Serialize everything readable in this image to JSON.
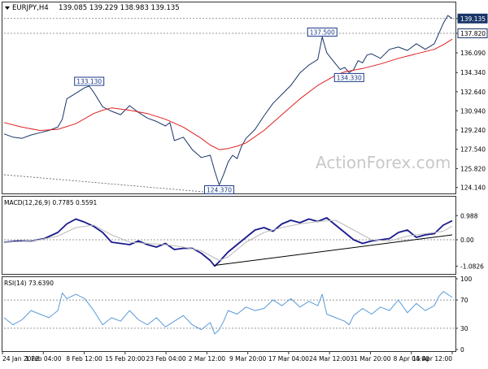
{
  "header": {
    "symbol": "EURJPY,H4",
    "ohlc": "139.085 139.229 138.983 139.135"
  },
  "watermark": "ActionForex.com",
  "colors": {
    "price": "#1a3568",
    "ma": "#e02020",
    "macd": "#1a1a8c",
    "signal": "#bbbbbb",
    "rsi": "#5a9ad8",
    "label_border": "#1a3a88",
    "current_price_box": "#1a3568"
  },
  "chart_data": [
    {
      "type": "line",
      "panel": "price",
      "ylim": [
        123.9,
        140.2
      ],
      "x_range": [
        0,
        100
      ],
      "y_ticks": [
        "139.135",
        "137.820",
        "136.090",
        "134.340",
        "132.640",
        "130.940",
        "129.240",
        "127.540",
        "125.820",
        "124.140"
      ],
      "y_tick_values": [
        139.135,
        137.82,
        136.09,
        134.34,
        132.64,
        130.94,
        129.24,
        127.54,
        125.82,
        124.14
      ],
      "current_price": "139.135",
      "series": [
        {
          "role": "price",
          "x": [
            0,
            2,
            4,
            6,
            8,
            10,
            12,
            13,
            14,
            16,
            18,
            19,
            20,
            22,
            24,
            26,
            28,
            30,
            32,
            34,
            36,
            37,
            38,
            40,
            42,
            44,
            46,
            47,
            48,
            49,
            50,
            51,
            52,
            53,
            54,
            56,
            58,
            60,
            62,
            64,
            66,
            68,
            70,
            71,
            72,
            73,
            74,
            75,
            76,
            77,
            78,
            79,
            80,
            81,
            82,
            84,
            86,
            88,
            90,
            92,
            94,
            96,
            97,
            98,
            99,
            100
          ],
          "values": [
            128.9,
            128.6,
            128.5,
            128.8,
            129.0,
            129.2,
            129.5,
            130.2,
            132.0,
            132.5,
            133.0,
            133.13,
            132.6,
            131.3,
            130.9,
            130.6,
            131.4,
            130.8,
            130.3,
            130.0,
            129.6,
            129.9,
            128.3,
            128.6,
            127.5,
            126.8,
            127.0,
            125.6,
            124.37,
            125.3,
            126.4,
            127.0,
            126.7,
            127.8,
            128.5,
            129.3,
            130.5,
            131.6,
            132.4,
            133.2,
            134.3,
            135.0,
            135.5,
            137.5,
            136.1,
            135.6,
            135.1,
            134.6,
            134.8,
            134.33,
            134.6,
            135.4,
            135.2,
            135.9,
            136.0,
            135.6,
            136.4,
            136.6,
            136.3,
            136.9,
            136.4,
            136.9,
            137.8,
            138.7,
            139.4,
            139.135
          ]
        },
        {
          "role": "moving-average",
          "x": [
            0,
            4,
            8,
            12,
            16,
            20,
            22,
            24,
            28,
            32,
            36,
            40,
            44,
            46,
            48,
            50,
            52,
            54,
            58,
            62,
            66,
            70,
            74,
            76,
            80,
            84,
            88,
            92,
            96,
            98,
            100
          ],
          "values": [
            129.9,
            129.5,
            129.2,
            129.3,
            129.8,
            130.7,
            131.0,
            131.2,
            131.0,
            130.7,
            130.2,
            129.5,
            128.5,
            127.9,
            127.5,
            127.6,
            127.8,
            128.1,
            129.2,
            130.6,
            132.0,
            133.2,
            134.1,
            134.4,
            134.7,
            135.1,
            135.6,
            136.0,
            136.4,
            136.8,
            137.3
          ]
        }
      ],
      "annotations": [
        "133.130",
        "124.370",
        "137.500",
        "134.330"
      ],
      "dotted_line_levels": [
        137.82,
        139.135
      ]
    },
    {
      "type": "line",
      "panel": "macd",
      "title": "MACD(12,26,9) 0.7785 0.5591",
      "ylim": [
        -1.3,
        1.3
      ],
      "y_ticks": [
        "0.988",
        "0.00",
        "-1.0826"
      ],
      "y_tick_values": [
        0.988,
        0.0,
        -1.0826
      ],
      "series": [
        {
          "role": "macd",
          "x": [
            0,
            3,
            6,
            9,
            12,
            14,
            16,
            18,
            20,
            22,
            24,
            26,
            28,
            30,
            32,
            34,
            36,
            38,
            40,
            42,
            44,
            46,
            47,
            48,
            50,
            52,
            54,
            56,
            58,
            60,
            62,
            64,
            66,
            68,
            70,
            72,
            74,
            76,
            78,
            80,
            82,
            84,
            86,
            88,
            90,
            92,
            94,
            96,
            98,
            100
          ],
          "values": [
            -0.1,
            -0.05,
            -0.05,
            0.05,
            0.3,
            0.65,
            0.85,
            0.72,
            0.55,
            0.3,
            -0.1,
            -0.15,
            -0.2,
            -0.05,
            -0.2,
            -0.3,
            -0.15,
            -0.4,
            -0.35,
            -0.35,
            -0.55,
            -0.85,
            -1.08,
            -0.9,
            -0.5,
            -0.2,
            0.1,
            0.4,
            0.5,
            0.35,
            0.65,
            0.8,
            0.7,
            0.85,
            0.75,
            0.9,
            0.6,
            0.3,
            0.0,
            -0.15,
            -0.05,
            0.0,
            0.05,
            0.3,
            0.4,
            0.1,
            0.2,
            0.25,
            0.6,
            0.78
          ]
        },
        {
          "role": "signal",
          "x": [
            0,
            4,
            8,
            12,
            16,
            20,
            24,
            28,
            32,
            36,
            40,
            44,
            46,
            48,
            50,
            54,
            58,
            62,
            66,
            70,
            74,
            78,
            82,
            86,
            90,
            94,
            98,
            100
          ],
          "values": [
            -0.1,
            -0.07,
            0.0,
            0.15,
            0.5,
            0.6,
            0.2,
            -0.1,
            -0.15,
            -0.2,
            -0.3,
            -0.45,
            -0.65,
            -0.85,
            -0.7,
            -0.1,
            0.3,
            0.5,
            0.65,
            0.75,
            0.8,
            0.4,
            0.0,
            -0.05,
            0.15,
            0.25,
            0.35,
            0.56
          ]
        }
      ],
      "trendline": {
        "x": [
          47,
          100
        ],
        "values": [
          -1.05,
          0.2
        ]
      }
    },
    {
      "type": "line",
      "panel": "rsi",
      "title": "RSI(14) 73.6390",
      "ylim": [
        0,
        100
      ],
      "y_ticks": [
        "100",
        "70",
        "30",
        "0"
      ],
      "y_tick_values": [
        100,
        70,
        30,
        0
      ],
      "levels": [
        70,
        30
      ],
      "series": [
        {
          "role": "rsi",
          "x": [
            0,
            2,
            4,
            6,
            8,
            10,
            12,
            13,
            14,
            16,
            18,
            20,
            22,
            24,
            26,
            28,
            30,
            32,
            34,
            36,
            38,
            40,
            42,
            44,
            46,
            47,
            48,
            49,
            50,
            52,
            54,
            56,
            58,
            60,
            62,
            64,
            66,
            68,
            70,
            71,
            72,
            74,
            76,
            77,
            78,
            80,
            82,
            84,
            86,
            88,
            90,
            92,
            94,
            96,
            97,
            98,
            99,
            100
          ],
          "values": [
            45,
            35,
            42,
            55,
            50,
            45,
            55,
            80,
            72,
            78,
            72,
            55,
            35,
            45,
            40,
            55,
            42,
            35,
            45,
            32,
            40,
            48,
            35,
            28,
            38,
            22,
            28,
            40,
            55,
            50,
            60,
            55,
            58,
            70,
            62,
            72,
            60,
            68,
            62,
            78,
            50,
            45,
            40,
            35,
            48,
            58,
            50,
            60,
            55,
            70,
            52,
            65,
            55,
            62,
            75,
            82,
            78,
            73.64
          ]
        }
      ]
    }
  ],
  "x_axis_labels": [
    "24 Jan 2022",
    "1 Feb 04:00",
    "8 Feb 12:00",
    "15 Feb 20:00",
    "23 Feb 04:00",
    "2 Mar 12:00",
    "9 Mar 20:00",
    "17 Mar 04:00",
    "24 Mar 12:00",
    "31 Mar 20:00",
    "8 Apr 04:00",
    "15 Apr 12:00"
  ]
}
